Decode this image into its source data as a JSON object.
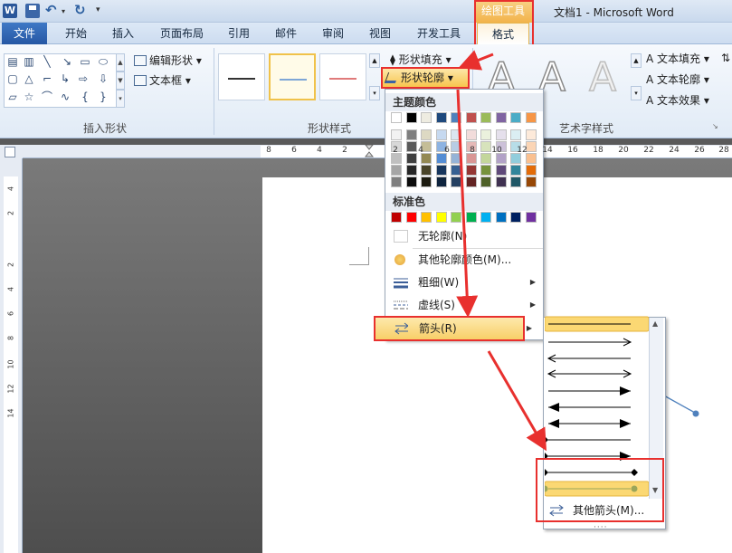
{
  "window": {
    "title": "文档1 - Microsoft Word",
    "contextual_group": "绘图工具"
  },
  "quick_access": {
    "app_icon": "W"
  },
  "tabs": [
    "文件",
    "开始",
    "插入",
    "页面布局",
    "引用",
    "邮件",
    "审阅",
    "视图",
    "开发工具",
    "格式"
  ],
  "ribbon": {
    "groups": {
      "insert_shapes": "插入形状",
      "shape_styles": "形状样式",
      "wordart_styles": "艺术字样式"
    },
    "edit_shape": "编辑形状",
    "text_box": "文本框",
    "shape_fill": "形状填充",
    "shape_outline": "形状轮廓",
    "text_fill": "文本填充",
    "text_outline": "文本轮廓",
    "text_effects": "文本效果",
    "wordart_letter": "A",
    "style_line_colors": [
      "#333333",
      "#7ea6d6",
      "#e07a7a"
    ]
  },
  "outline_menu": {
    "theme_colors_label": "主题颜色",
    "theme_colors_top": [
      "#ffffff",
      "#000000",
      "#eeece1",
      "#1f497d",
      "#4f81bd",
      "#c0504d",
      "#9bbb59",
      "#8064a2",
      "#4bacc6",
      "#f79646"
    ],
    "theme_shades": [
      [
        "#f2f2f2",
        "#7f7f7f",
        "#ddd9c3",
        "#c6d9f0",
        "#dbe5f1",
        "#f2dcdb",
        "#ebf1dd",
        "#e5e0ec",
        "#dbeef3",
        "#fdeada"
      ],
      [
        "#d8d8d8",
        "#595959",
        "#c4bd97",
        "#8db3e2",
        "#b8cce4",
        "#e5b9b7",
        "#d7e3bc",
        "#ccc1d9",
        "#b7dde8",
        "#fbd5b5"
      ],
      [
        "#bfbfbf",
        "#3f3f3f",
        "#938953",
        "#548dd4",
        "#95b3d7",
        "#d99694",
        "#c3d69b",
        "#b2a2c7",
        "#92cddc",
        "#fac08f"
      ],
      [
        "#a5a5a5",
        "#262626",
        "#494429",
        "#17365d",
        "#366092",
        "#953734",
        "#76923c",
        "#5f497a",
        "#31859b",
        "#e36c09"
      ],
      [
        "#7f7f7f",
        "#0c0c0c",
        "#1d1b10",
        "#0f243e",
        "#244061",
        "#632423",
        "#4f6128",
        "#3f3151",
        "#205867",
        "#974806"
      ]
    ],
    "standard_colors_label": "标准色",
    "standard_colors": [
      "#c00000",
      "#ff0000",
      "#ffc000",
      "#ffff00",
      "#92d050",
      "#00b050",
      "#00b0f0",
      "#0070c0",
      "#002060",
      "#7030a0"
    ],
    "no_outline": "无轮廓(N)",
    "more_colors": "其他轮廓颜色(M)...",
    "weight": "粗细(W)",
    "dashes": "虚线(S)",
    "arrows": "箭头(R)"
  },
  "arrow_submenu": {
    "more_arrows": "其他箭头(M)..."
  },
  "ruler": {
    "top_numbers": [
      "8",
      "6",
      "4",
      "2",
      "2",
      "4",
      "6",
      "8",
      "10",
      "12",
      "14",
      "16",
      "18",
      "20",
      "22",
      "24",
      "26",
      "28"
    ],
    "left_numbers": [
      "4",
      "2",
      "2",
      "4",
      "6",
      "8",
      "10",
      "12",
      "14"
    ]
  }
}
